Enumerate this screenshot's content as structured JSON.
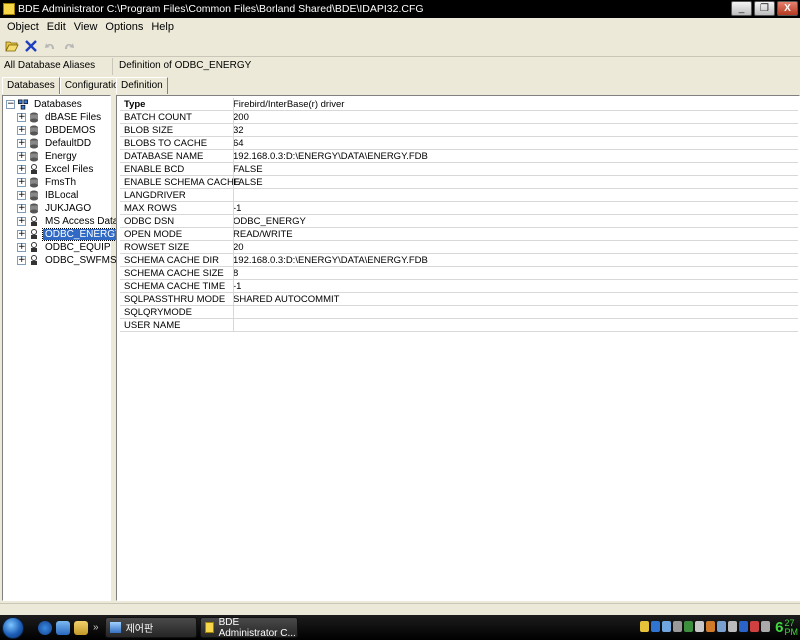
{
  "window": {
    "title": "BDE Administrator  C:\\Program Files\\Common Files\\Borland Shared\\BDE\\IDAPI32.CFG",
    "minimize_glyph": "_",
    "restore_glyph": "❐",
    "close_glyph": "X"
  },
  "menu": [
    "Object",
    "Edit",
    "View",
    "Options",
    "Help"
  ],
  "toolbar": {
    "icons": [
      "open-folder-icon",
      "delete-x-icon",
      "undo-icon",
      "redo-icon"
    ]
  },
  "left_header": "All Database Aliases",
  "right_header": "Definition of ODBC_ENERGY",
  "left_tabs": [
    "Databases",
    "Configuration"
  ],
  "right_tabs": [
    "Definition"
  ],
  "tree": {
    "root": "Databases",
    "root_glyph": "−",
    "expand_glyph": "+",
    "items": [
      "dBASE Files",
      "DBDEMOS",
      "DefaultDD",
      "Energy",
      "Excel Files",
      "FmsTh",
      "IBLocal",
      "JUKJAGO",
      "MS Access Database",
      "ODBC_ENERGY",
      "ODBC_EQUIP",
      "ODBC_SWFMS"
    ],
    "selected": "ODBC_ENERGY"
  },
  "definition": [
    {
      "key": "Type",
      "value": "Firebird/InterBase(r) driver"
    },
    {
      "key": "BATCH COUNT",
      "value": "200"
    },
    {
      "key": "BLOB SIZE",
      "value": "32"
    },
    {
      "key": "BLOBS TO CACHE",
      "value": "64"
    },
    {
      "key": "DATABASE NAME",
      "value": "192.168.0.3:D:\\ENERGY\\DATA\\ENERGY.FDB"
    },
    {
      "key": "ENABLE BCD",
      "value": "FALSE"
    },
    {
      "key": "ENABLE SCHEMA CACHE",
      "value": "FALSE"
    },
    {
      "key": "LANGDRIVER",
      "value": ""
    },
    {
      "key": "MAX ROWS",
      "value": "-1"
    },
    {
      "key": "ODBC DSN",
      "value": "ODBC_ENERGY"
    },
    {
      "key": "OPEN MODE",
      "value": "READ/WRITE"
    },
    {
      "key": "ROWSET SIZE",
      "value": "20"
    },
    {
      "key": "SCHEMA CACHE DIR",
      "value": "192.168.0.3:D:\\ENERGY\\DATA\\ENERGY.FDB"
    },
    {
      "key": "SCHEMA CACHE SIZE",
      "value": "8"
    },
    {
      "key": "SCHEMA CACHE TIME",
      "value": "-1"
    },
    {
      "key": "SQLPASSTHRU MODE",
      "value": "SHARED AUTOCOMMIT"
    },
    {
      "key": "SQLQRYMODE",
      "value": ""
    },
    {
      "key": "USER NAME",
      "value": ""
    }
  ],
  "taskbar": {
    "quicklaunch_arrow": "»",
    "buttons": [
      {
        "label": "제어판"
      },
      {
        "label": "BDE Administrator  C..."
      }
    ],
    "clock_hour": "6",
    "clock_min": "27",
    "clock_ampm": "PM"
  },
  "colors": {
    "selection": "#316ac5",
    "clock": "#3fd93f",
    "title_bg": "#000000"
  }
}
